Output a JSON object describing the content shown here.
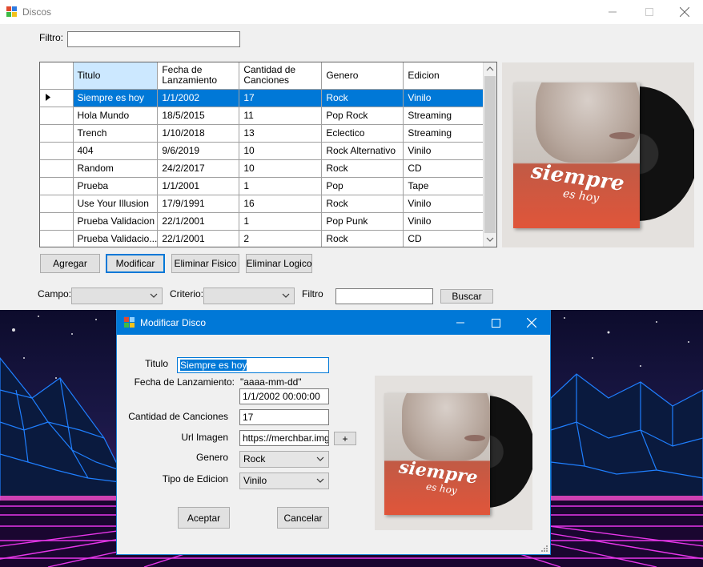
{
  "main": {
    "title": "Discos",
    "filtro_label": "Filtro:",
    "filtro_value": "",
    "grid": {
      "columns": [
        "Titulo",
        "Fecha de\nLanzamiento",
        "Cantidad de\nCanciones",
        "Genero",
        "Edicion"
      ],
      "rows": [
        [
          "Siempre es hoy",
          "1/1/2002",
          "17",
          "Rock",
          "Vinilo"
        ],
        [
          "Hola Mundo",
          "18/5/2015",
          "11",
          "Pop Rock",
          "Streaming"
        ],
        [
          "Trench",
          "1/10/2018",
          "13",
          "Eclectico",
          "Streaming"
        ],
        [
          "404",
          "9/6/2019",
          "10",
          "Rock Alternativo",
          "Vinilo"
        ],
        [
          "Random",
          "24/2/2017",
          "10",
          "Rock",
          "CD"
        ],
        [
          "Prueba",
          "1/1/2001",
          "1",
          "Pop",
          "Tape"
        ],
        [
          "Use Your Illusion",
          "17/9/1991",
          "16",
          "Rock",
          "Vinilo"
        ],
        [
          "Prueba Validacion",
          "22/1/2001",
          "1",
          "Pop Punk",
          "Vinilo"
        ],
        [
          "Prueba Validacio...",
          "22/1/2001",
          "2",
          "Rock",
          "CD"
        ]
      ],
      "selected_row": 0
    },
    "buttons": {
      "agregar": "Agregar",
      "modificar": "Modificar",
      "eliminar_fisico": "Eliminar Fisico",
      "eliminar_logico": "Eliminar Logico",
      "buscar": "Buscar"
    },
    "search": {
      "campo_label": "Campo:",
      "criterio_label": "Criterio:",
      "filtro_label": "Filtro",
      "campo_value": "",
      "criterio_value": "",
      "filtro_value": ""
    }
  },
  "dialog": {
    "title": "Modificar Disco",
    "labels": {
      "titulo": "Titulo",
      "fecha": "Fecha de Lanzamiento:",
      "fecha_hint": "\"aaaa-mm-dd\"",
      "cantidad": "Cantidad de Canciones",
      "url": "Url Imagen",
      "genero": "Genero",
      "tipo": "Tipo de Edicion"
    },
    "values": {
      "titulo": "Siempre es hoy",
      "fecha": "1/1/2002 00:00:00",
      "cantidad": "17",
      "url": "https://merchbar.imgix",
      "genero": "Rock",
      "tipo": "Vinilo"
    },
    "add_button": "+",
    "aceptar": "Aceptar",
    "cancelar": "Cancelar"
  },
  "cover_art": {
    "line1": "siempre",
    "line2": "es hoy"
  },
  "colors": {
    "accent": "#0078d7",
    "selection_header": "#cce8ff"
  }
}
